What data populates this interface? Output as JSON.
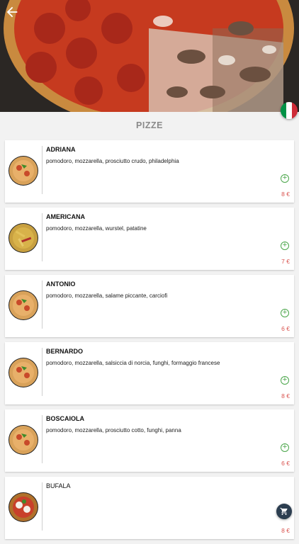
{
  "header": {
    "back_icon": "arrow-left-icon",
    "language_flag": "italian-flag-icon",
    "flag_colors": [
      "#009246",
      "#ffffff",
      "#ce2b37"
    ]
  },
  "section": {
    "title": "PIZZE"
  },
  "menu_items": [
    {
      "name": "ADRIANA",
      "description": "pomodoro, mozzarella, prosciutto crudo, philadelphia",
      "price": "8 €"
    },
    {
      "name": "AMERICANA",
      "description": "pomodoro, mozzarella, wurstel, patatine",
      "price": "7 €"
    },
    {
      "name": "ANTONIO",
      "description": "pomodoro, mozzarella, salame piccante, carciofi",
      "price": "6 €"
    },
    {
      "name": "BERNARDO",
      "description": "pomodoro, mozzarella, salsiccia di norcia, funghi, formaggio francese",
      "price": "8 €"
    },
    {
      "name": "BOSCAIOLA",
      "description": "pomodoro, mozzarella, prosciutto cotto, funghi, panna",
      "price": "6 €"
    },
    {
      "name": "BUFALA",
      "description": "",
      "price": "8 €"
    }
  ],
  "colors": {
    "add_icon": "#4aa64a",
    "price": "#d9534f",
    "cart_button": "#2c3e50"
  },
  "cart": {
    "icon": "shopping-cart-icon"
  }
}
